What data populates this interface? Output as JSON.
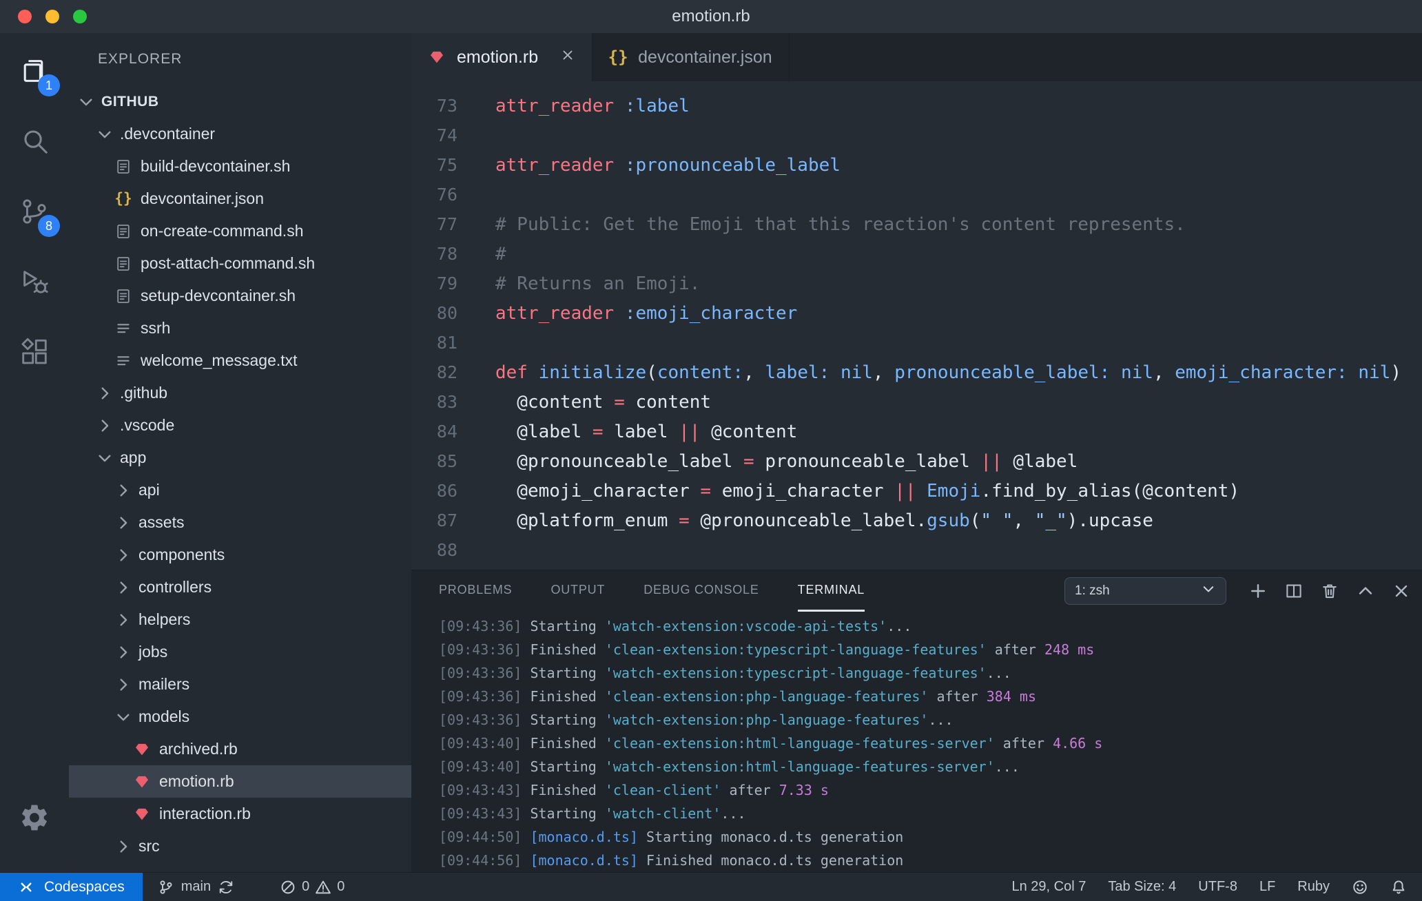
{
  "window": {
    "title": "emotion.rb"
  },
  "colors": {
    "accent_blue": "#2f81f7",
    "remote_statusbar_bg": "#0b6ed6",
    "ruby_icon": "#ec5f6e",
    "json_icon": "#d9b64a",
    "code_keyword": "#f97583",
    "code_constant": "#79b8ff",
    "code_string": "#9ecbff",
    "code_comment": "#6a737d"
  },
  "activity_bar": {
    "items": [
      {
        "id": "explorer",
        "icon": "files-icon",
        "badge": "1",
        "active": true
      },
      {
        "id": "search",
        "icon": "search-icon"
      },
      {
        "id": "source-control",
        "icon": "source-control-icon",
        "badge": "8"
      },
      {
        "id": "run-debug",
        "icon": "run-debug-icon"
      },
      {
        "id": "extensions",
        "icon": "extensions-icon"
      }
    ],
    "bottom_items": [
      {
        "id": "settings",
        "icon": "gear-icon"
      }
    ]
  },
  "sidebar": {
    "title": "EXPLORER",
    "items": [
      {
        "label": "GITHUB",
        "kind": "folder",
        "expanded": true,
        "depth": 0,
        "root": true
      },
      {
        "label": ".devcontainer",
        "kind": "folder",
        "expanded": true,
        "depth": 1
      },
      {
        "label": "build-devcontainer.sh",
        "kind": "file",
        "ftype": "sh",
        "depth": 2
      },
      {
        "label": "devcontainer.json",
        "kind": "file",
        "ftype": "json",
        "depth": 2
      },
      {
        "label": "on-create-command.sh",
        "kind": "file",
        "ftype": "sh",
        "depth": 2
      },
      {
        "label": "post-attach-command.sh",
        "kind": "file",
        "ftype": "sh",
        "depth": 2
      },
      {
        "label": "setup-devcontainer.sh",
        "kind": "file",
        "ftype": "sh",
        "depth": 2
      },
      {
        "label": "ssrh",
        "kind": "file",
        "ftype": "txt",
        "depth": 2
      },
      {
        "label": "welcome_message.txt",
        "kind": "file",
        "ftype": "txt",
        "depth": 2
      },
      {
        "label": ".github",
        "kind": "folder",
        "expanded": false,
        "depth": 1
      },
      {
        "label": ".vscode",
        "kind": "folder",
        "expanded": false,
        "depth": 1
      },
      {
        "label": "app",
        "kind": "folder",
        "expanded": true,
        "depth": 1
      },
      {
        "label": "api",
        "kind": "folder",
        "expanded": false,
        "depth": 2
      },
      {
        "label": "assets",
        "kind": "folder",
        "expanded": false,
        "depth": 2
      },
      {
        "label": "components",
        "kind": "folder",
        "expanded": false,
        "depth": 2
      },
      {
        "label": "controllers",
        "kind": "folder",
        "expanded": false,
        "depth": 2
      },
      {
        "label": "helpers",
        "kind": "folder",
        "expanded": false,
        "depth": 2
      },
      {
        "label": "jobs",
        "kind": "folder",
        "expanded": false,
        "depth": 2
      },
      {
        "label": "mailers",
        "kind": "folder",
        "expanded": false,
        "depth": 2
      },
      {
        "label": "models",
        "kind": "folder",
        "expanded": true,
        "depth": 2
      },
      {
        "label": "archived.rb",
        "kind": "file",
        "ftype": "rb",
        "depth": 3
      },
      {
        "label": "emotion.rb",
        "kind": "file",
        "ftype": "rb",
        "depth": 3,
        "selected": true
      },
      {
        "label": "interaction.rb",
        "kind": "file",
        "ftype": "rb",
        "depth": 3
      },
      {
        "label": "src",
        "kind": "folder",
        "expanded": false,
        "depth": 2
      }
    ]
  },
  "editor": {
    "tabs": [
      {
        "label": "emotion.rb",
        "icon": "ruby-file-icon",
        "active": true
      },
      {
        "label": "devcontainer.json",
        "icon": "json-file-icon",
        "active": false
      }
    ],
    "lines": [
      {
        "num": "73",
        "tokens": [
          [
            "r",
            "attr_reader"
          ],
          [
            "w",
            " "
          ],
          [
            "b",
            ":label"
          ]
        ]
      },
      {
        "num": "74",
        "tokens": []
      },
      {
        "num": "75",
        "tokens": [
          [
            "r",
            "attr_reader"
          ],
          [
            "w",
            " "
          ],
          [
            "b",
            ":pronounceable_label"
          ]
        ]
      },
      {
        "num": "76",
        "tokens": []
      },
      {
        "num": "77",
        "tokens": [
          [
            "c",
            "# Public: Get the Emoji that this reaction's content represents."
          ]
        ]
      },
      {
        "num": "78",
        "tokens": [
          [
            "c",
            "#"
          ]
        ]
      },
      {
        "num": "79",
        "tokens": [
          [
            "c",
            "# Returns an Emoji."
          ]
        ]
      },
      {
        "num": "80",
        "tokens": [
          [
            "r",
            "attr_reader"
          ],
          [
            "w",
            " "
          ],
          [
            "b",
            ":emoji_character"
          ]
        ]
      },
      {
        "num": "81",
        "tokens": []
      },
      {
        "num": "82",
        "tokens": [
          [
            "r",
            "def"
          ],
          [
            "w",
            " "
          ],
          [
            "b",
            "initialize"
          ],
          [
            "w",
            "("
          ],
          [
            "b",
            "content:"
          ],
          [
            "w",
            ", "
          ],
          [
            "b",
            "label:"
          ],
          [
            "w",
            " "
          ],
          [
            "b",
            "nil"
          ],
          [
            "w",
            ", "
          ],
          [
            "b",
            "pronounceable_label:"
          ],
          [
            "w",
            " "
          ],
          [
            "b",
            "nil"
          ],
          [
            "w",
            ", "
          ],
          [
            "b",
            "emoji_character:"
          ],
          [
            "w",
            " "
          ],
          [
            "b",
            "nil"
          ],
          [
            "w",
            ")"
          ]
        ]
      },
      {
        "num": "83",
        "tokens": [
          [
            "w",
            "  @content "
          ],
          [
            "r",
            "="
          ],
          [
            "w",
            " content"
          ]
        ]
      },
      {
        "num": "84",
        "tokens": [
          [
            "w",
            "  @label "
          ],
          [
            "r",
            "="
          ],
          [
            "w",
            " label "
          ],
          [
            "r",
            "||"
          ],
          [
            "w",
            " @content"
          ]
        ]
      },
      {
        "num": "85",
        "tokens": [
          [
            "w",
            "  @pronounceable_label "
          ],
          [
            "r",
            "="
          ],
          [
            "w",
            " pronounceable_label "
          ],
          [
            "r",
            "||"
          ],
          [
            "w",
            " @label"
          ]
        ]
      },
      {
        "num": "86",
        "tokens": [
          [
            "w",
            "  @emoji_character "
          ],
          [
            "r",
            "="
          ],
          [
            "w",
            " emoji_character "
          ],
          [
            "r",
            "||"
          ],
          [
            "w",
            " "
          ],
          [
            "b",
            "Emoji"
          ],
          [
            "w",
            ".find_by_alias(@content)"
          ]
        ]
      },
      {
        "num": "87",
        "tokens": [
          [
            "w",
            "  @platform_enum "
          ],
          [
            "r",
            "="
          ],
          [
            "w",
            " @pronounceable_label."
          ],
          [
            "b",
            "gsub"
          ],
          [
            "w",
            "("
          ],
          [
            "s",
            "\" \""
          ],
          [
            "w",
            ", "
          ],
          [
            "s",
            "\"_\""
          ],
          [
            "w",
            ").upcase"
          ]
        ]
      },
      {
        "num": "88",
        "tokens": []
      }
    ]
  },
  "panel": {
    "tabs": [
      {
        "label": "PROBLEMS",
        "active": false
      },
      {
        "label": "OUTPUT",
        "active": false
      },
      {
        "label": "DEBUG CONSOLE",
        "active": false
      },
      {
        "label": "TERMINAL",
        "active": true
      }
    ],
    "shell_selector": "1: zsh",
    "terminal_lines": [
      {
        "tokens": [
          [
            "g",
            "[09:43:36] "
          ],
          [
            "d",
            "Starting "
          ],
          [
            "c",
            "'watch-extension:vscode-api-tests'"
          ],
          [
            "d",
            "..."
          ]
        ]
      },
      {
        "tokens": [
          [
            "g",
            "[09:43:36] "
          ],
          [
            "d",
            "Finished "
          ],
          [
            "c",
            "'clean-extension:typescript-language-features'"
          ],
          [
            "d",
            " after "
          ],
          [
            "m",
            "248 ms"
          ]
        ]
      },
      {
        "tokens": [
          [
            "g",
            "[09:43:36] "
          ],
          [
            "d",
            "Starting "
          ],
          [
            "c",
            "'watch-extension:typescript-language-features'"
          ],
          [
            "d",
            "..."
          ]
        ]
      },
      {
        "tokens": [
          [
            "g",
            "[09:43:36] "
          ],
          [
            "d",
            "Finished "
          ],
          [
            "c",
            "'clean-extension:php-language-features'"
          ],
          [
            "d",
            " after "
          ],
          [
            "m",
            "384 ms"
          ]
        ]
      },
      {
        "tokens": [
          [
            "g",
            "[09:43:36] "
          ],
          [
            "d",
            "Starting "
          ],
          [
            "c",
            "'watch-extension:php-language-features'"
          ],
          [
            "d",
            "..."
          ]
        ]
      },
      {
        "tokens": [
          [
            "g",
            "[09:43:40] "
          ],
          [
            "d",
            "Finished "
          ],
          [
            "c",
            "'clean-extension:html-language-features-server'"
          ],
          [
            "d",
            " after "
          ],
          [
            "m",
            "4.66 s"
          ]
        ]
      },
      {
        "tokens": [
          [
            "g",
            "[09:43:40] "
          ],
          [
            "d",
            "Starting "
          ],
          [
            "c",
            "'watch-extension:html-language-features-server'"
          ],
          [
            "d",
            "..."
          ]
        ]
      },
      {
        "tokens": [
          [
            "g",
            "[09:43:43] "
          ],
          [
            "d",
            "Finished "
          ],
          [
            "c",
            "'clean-client'"
          ],
          [
            "d",
            " after "
          ],
          [
            "m",
            "7.33 s"
          ]
        ]
      },
      {
        "tokens": [
          [
            "g",
            "[09:43:43] "
          ],
          [
            "d",
            "Starting "
          ],
          [
            "c",
            "'watch-client'"
          ],
          [
            "d",
            "..."
          ]
        ]
      },
      {
        "tokens": [
          [
            "g",
            "[09:44:50] "
          ],
          [
            "b",
            "[monaco.d.ts] "
          ],
          [
            "d",
            "Starting monaco.d.ts generation"
          ]
        ]
      },
      {
        "tokens": [
          [
            "g",
            "[09:44:56] "
          ],
          [
            "b",
            "[monaco.d.ts] "
          ],
          [
            "d",
            "Finished monaco.d.ts generation"
          ]
        ]
      }
    ]
  },
  "status_bar": {
    "remote": "Codespaces",
    "branch": "main",
    "errors": "0",
    "warnings": "0",
    "right_items": [
      {
        "id": "cursor-position",
        "label": "Ln 29, Col 7"
      },
      {
        "id": "indentation",
        "label": "Tab Size: 4"
      },
      {
        "id": "encoding",
        "label": "UTF-8"
      },
      {
        "id": "eol",
        "label": "LF"
      },
      {
        "id": "language-mode",
        "label": "Ruby"
      }
    ]
  }
}
